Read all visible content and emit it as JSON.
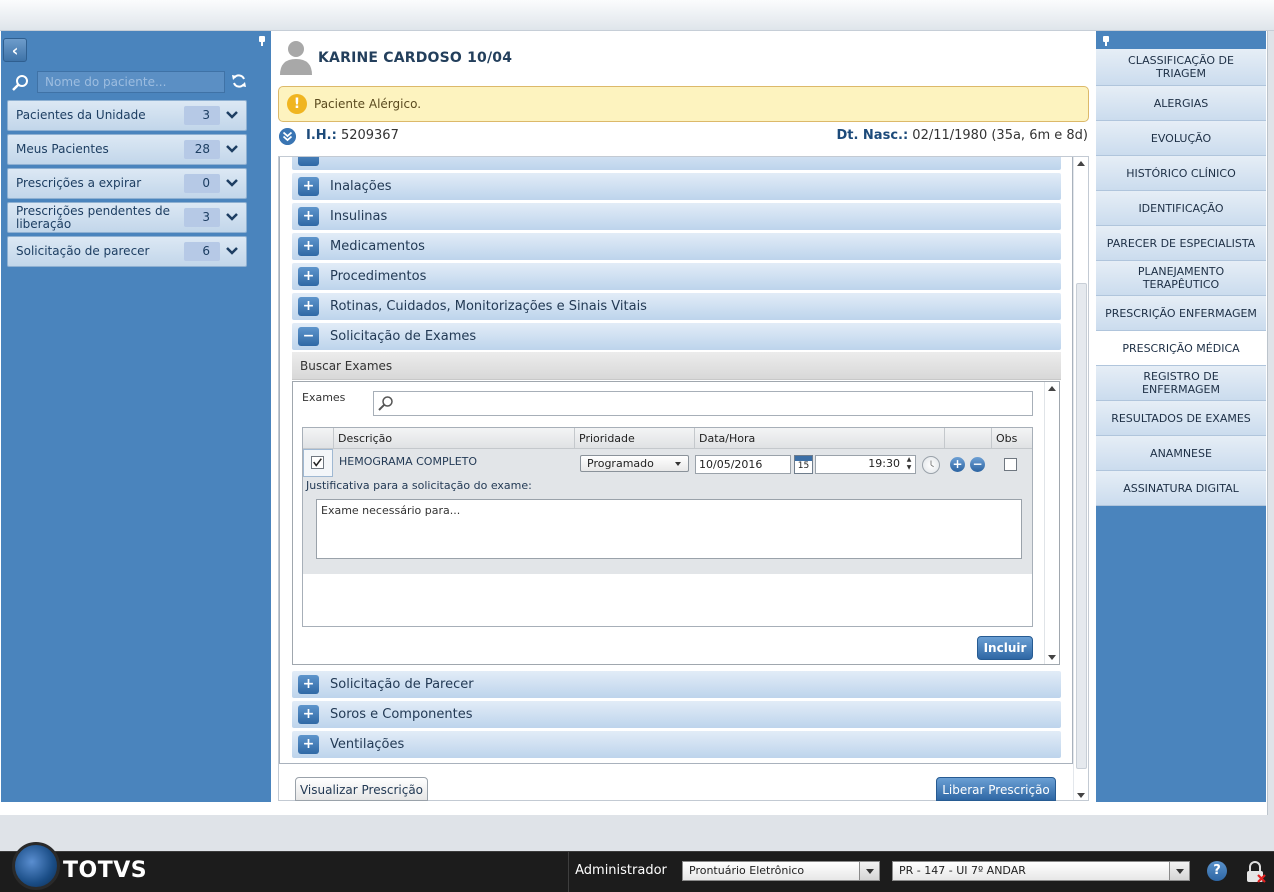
{
  "sidebar": {
    "search_placeholder": "Nome do paciente...",
    "groups": [
      {
        "label": "Pacientes da Unidade",
        "count": "3"
      },
      {
        "label": "Meus Pacientes",
        "count": "28"
      },
      {
        "label": "Prescrições a expirar",
        "count": "0"
      },
      {
        "label": "Prescrições pendentes de liberação",
        "count": "3"
      },
      {
        "label": "Solicitação de parecer",
        "count": "6"
      }
    ]
  },
  "patient": {
    "name": "KARINE CARDOSO 10/04",
    "alert": "Paciente Alérgico.",
    "alert_icon": "!",
    "ih_label": "I.H.:",
    "ih_value": "5209367",
    "dob_label": "Dt. Nasc.:",
    "dob_value": "02/11/1980 (35a, 6m e 8d)"
  },
  "sections": {
    "inalacoes": "Inalações",
    "insulinas": "Insulinas",
    "medicamentos": "Medicamentos",
    "procedimentos": "Procedimentos",
    "rotinas": "Rotinas, Cuidados, Monitorizações e Sinais Vitais",
    "solicitacao_exames": "Solicitação de Exames",
    "solicitacao_parecer": "Solicitação de Parecer",
    "soros": "Soros e Componentes",
    "ventilacoes": "Ventilações",
    "plus": "+",
    "minus": "−"
  },
  "exams": {
    "header": "Buscar Exames",
    "search_label": "Exames",
    "columns": {
      "descricao": "Descrição",
      "prioridade": "Prioridade",
      "data_hora": "Data/Hora",
      "obs": "Obs"
    },
    "row": {
      "description": "HEMOGRAMA COMPLETO",
      "priority": "Programado",
      "date": "10/05/2016",
      "calendar_day": "15",
      "time": "19:30",
      "justification_label": "Justificativa para a solicitação do exame:",
      "justification_text": "Exame necessário para...",
      "checked": true
    },
    "include_button": "Incluir"
  },
  "footer": {
    "view_button": "Visualizar Prescrição",
    "release_button": "Liberar Prescrição"
  },
  "right_menu": [
    "CLASSIFICAÇÃO DE TRIAGEM",
    "ALERGIAS",
    "EVOLUÇÃO",
    "HISTÓRICO CLÍNICO",
    "IDENTIFICAÇÃO",
    "PARECER DE ESPECIALISTA",
    "PLANEJAMENTO TERAPÊUTICO",
    "PRESCRIÇÃO ENFERMAGEM",
    "PRESCRIÇÃO MÉDICA",
    "REGISTRO DE ENFERMAGEM",
    "RESULTADOS DE EXAMES",
    "ANAMNESE",
    "ASSINATURA DIGITAL"
  ],
  "right_menu_active": "PRESCRIÇÃO MÉDICA",
  "taskbar": {
    "brand": "TOTVS",
    "user": "Administrador",
    "module": "Prontuário Eletrônico",
    "unit": "PR - 147 - UI 7º ANDAR",
    "help": "?"
  },
  "colors": {
    "sidebar_bg": "#4a84bd",
    "accent": "#2f67a4",
    "alert_bg": "#fdf3bf"
  }
}
